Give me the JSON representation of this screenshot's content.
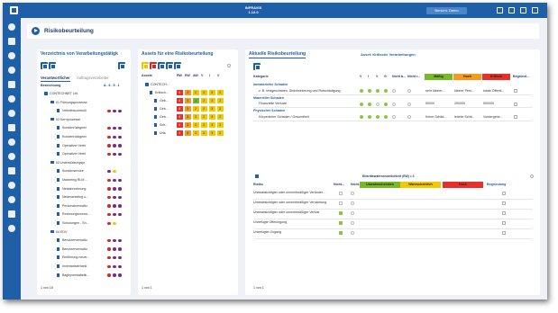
{
  "app": {
    "title_line1": "INFRAVIS",
    "title_line2": "1.12.0",
    "user_button": "Benicht: Demo"
  },
  "page": {
    "title": "Risikobeurteilung"
  },
  "colors": {
    "brand": "#1f5fa8",
    "red": "#e8302a",
    "orange": "#f49a1f",
    "yellow": "#f2c800",
    "green": "#79b829",
    "purple": "#7b2a8a"
  },
  "sidebar_icons": [
    "home-icon",
    "layers-icon",
    "dashboard-icon",
    "gear-icon",
    "clock-icon",
    "calendar-icon",
    "list-icon",
    "document-icon",
    "chart-icon",
    "shield-icon",
    "location-icon",
    "user-icon",
    "report-icon",
    "grid-icon",
    "globe-icon"
  ],
  "left_panel": {
    "title": "Verzeichnis von Verarbeitungstätigk",
    "tabs": [
      "Verantwortlicher",
      "Auftragsverarbeiter"
    ],
    "col_label": "Bezeichnung",
    "col_marks": "A . 6 . 5 . 1",
    "tree": [
      {
        "label": "CONTECHNET Ltd.",
        "level": 0,
        "kind": "folder",
        "dots": []
      },
      {
        "label": "01 Führungsprozesse",
        "level": 1,
        "kind": "folder",
        "dots": []
      },
      {
        "label": "Vertriebscontrolli",
        "level": 2,
        "kind": "doc",
        "dots": [
          "#d62828",
          "#7b2a8a",
          "#7b2a8a"
        ]
      },
      {
        "label": "02 Kernprozesse",
        "level": 1,
        "kind": "folder",
        "dots": []
      },
      {
        "label": "Kundenrückgewi",
        "level": 2,
        "kind": "doc",
        "dots": [
          "#d62828",
          "#7b2a8a",
          "#7b2a8a"
        ]
      },
      {
        "label": "Kundenrückgewi",
        "level": 2,
        "kind": "doc",
        "dots": [
          "#d62828",
          "#7b2a8a",
          "#7b2a8a"
        ]
      },
      {
        "label": "Operativer Vertri",
        "level": 2,
        "kind": "doc",
        "dots": [
          "#d62828",
          "#7b2a8a",
          "#7b2a8a"
        ]
      },
      {
        "label": "Operativer Vertri",
        "level": 2,
        "kind": "doc",
        "dots": [
          "#d62828",
          "#7b2a8a",
          "#7b2a8a"
        ]
      },
      {
        "label": "03 Unterstützungspr",
        "level": 1,
        "kind": "folder",
        "dots": []
      },
      {
        "label": "Kundenservice",
        "level": 2,
        "kind": "doc",
        "dots": [
          "#7b2a8a",
          "#f2c800"
        ]
      },
      {
        "label": "Marketing RLM ...",
        "level": 2,
        "kind": "doc",
        "dots": [
          "#d62828",
          "#7b2a8a",
          "#7b2a8a"
        ]
      },
      {
        "label": "Netzabrechnung",
        "level": 2,
        "kind": "doc",
        "dots": [
          "#d62828",
          "#7b2a8a",
          "#7b2a8a"
        ]
      },
      {
        "label": "Netzmarketing u...",
        "level": 2,
        "kind": "doc",
        "dots": [
          "#d62828",
          "#7b2a8a",
          "#7b2a8a"
        ]
      },
      {
        "label": "Personalverwaltu",
        "level": 2,
        "kind": "doc",
        "dots": [
          "#d62828",
          "#7b2a8a",
          "#7b2a8a"
        ]
      },
      {
        "label": "Rechnungsverwa...",
        "level": 2,
        "kind": "doc",
        "dots": [
          "#d62828",
          "#7b2a8a",
          "#7b2a8a"
        ]
      },
      {
        "label": "Schulungen - Sh...",
        "level": 2,
        "kind": "doc",
        "dots": [
          "#d62828",
          "#f2c800"
        ]
      },
      {
        "label": "04 EDV",
        "level": 1,
        "kind": "folder",
        "dots": []
      },
      {
        "label": "Benutzerverwaltu",
        "level": 2,
        "kind": "doc",
        "dots": [
          "#d62828",
          "#7b2a8a",
          "#7b2a8a"
        ]
      },
      {
        "label": "Benutzerverwaltu",
        "level": 2,
        "kind": "doc",
        "dots": [
          "#d62828",
          "#7b2a8a",
          "#7b2a8a"
        ]
      },
      {
        "label": "Einführung neuer...",
        "level": 2,
        "kind": "doc",
        "dots": [
          "#d62828",
          "#7b2a8a",
          "#7b2a8a"
        ]
      },
      {
        "label": "Inventarisierbank",
        "level": 2,
        "kind": "doc",
        "dots": [
          "#d62828",
          "#7b2a8a",
          "#7b2a8a"
        ]
      },
      {
        "label": "Bagbyverstatistik...",
        "level": 2,
        "kind": "doc",
        "dots": [
          "#d62828",
          "#7b2a8a",
          "#7b2a8a"
        ]
      }
    ],
    "footer": "1 von 18"
  },
  "mid_panel": {
    "title": "Assets für eine Risikobeurteilung",
    "col_label": "Assets",
    "headers": [
      "RW",
      "EW",
      "AW",
      "V",
      "I",
      "V"
    ],
    "rows": [
      {
        "label": "CONTECH...",
        "level": 0,
        "vals": []
      },
      {
        "label": "Kritisch...",
        "level": 1,
        "vals": [
          [
            "4",
            "c-r"
          ],
          [
            "3",
            "c-o"
          ],
          [
            "2",
            "c-y"
          ],
          [
            "2",
            "c-y"
          ],
          [
            "3",
            "c-y"
          ],
          [
            "2",
            "c-y"
          ]
        ]
      },
      {
        "label": "Geb...",
        "level": 2,
        "vals": [
          [
            "4",
            "c-r"
          ],
          [
            "3",
            "c-o"
          ],
          [
            "1",
            "c-g"
          ],
          [
            "2",
            "c-y"
          ],
          [
            "3",
            "c-y"
          ],
          [
            "2",
            "c-y"
          ]
        ]
      },
      {
        "label": "Geb...",
        "level": 2,
        "vals": [
          [
            "4",
            "c-r"
          ],
          [
            "3",
            "c-o"
          ],
          [
            "2",
            "c-y"
          ],
          [
            "2",
            "c-y"
          ],
          [
            "3",
            "c-y"
          ],
          [
            "2",
            "c-y"
          ]
        ]
      },
      {
        "label": "Geb...",
        "level": 2,
        "vals": [
          [
            "4",
            "c-r"
          ],
          [
            "3",
            "c-o"
          ],
          [
            "2",
            "c-y"
          ],
          [
            "2",
            "c-y"
          ],
          [
            "3",
            "c-y"
          ],
          [
            "2",
            "c-y"
          ]
        ]
      },
      {
        "label": "Sch...",
        "level": 2,
        "vals": [
          [
            "4",
            "c-r"
          ],
          [
            "3",
            "c-o"
          ],
          [
            "2",
            "c-y"
          ],
          [
            "2",
            "c-y"
          ],
          [
            "3",
            "c-y"
          ],
          [
            "2",
            "c-y"
          ]
        ]
      },
      {
        "label": "Urla",
        "level": 2,
        "vals": [
          [
            "4",
            "c-r"
          ],
          [
            "3",
            "c-o"
          ],
          [
            "2",
            "c-y"
          ],
          [
            "2",
            "c-y"
          ],
          [
            "3",
            "c-y"
          ],
          [
            "2",
            "c-y"
          ]
        ]
      }
    ],
    "footer": "1 von 1"
  },
  "right_panel": {
    "title": "Aktuelle Risikobeurteilung",
    "tab2": "Asset: Kritische Verarbeitungen",
    "top_headers": {
      "kategorie": "Kategorie",
      "v": "V",
      "i": "I",
      "v2": "V",
      "g": "G",
      "nicht_b": "Nicht b...",
      "nicht_r": "Nicht r...",
      "low": "Mäßig",
      "med": "Hoch",
      "high": "Kritisch",
      "begr": "Begründ..."
    },
    "top_rows": [
      {
        "type": "cat",
        "label": "Immaterieller Schaden"
      },
      {
        "type": "data",
        "label": "z. B. Imageschaden, Diskriminierung und Rufschädigung",
        "checks": [
          "on",
          "on",
          "on",
          "on",
          "off",
          "off"
        ],
        "cells": [
          "sehr kleiner...",
          "kleiner Pers...",
          "totale Öffentl..."
        ]
      },
      {
        "type": "cat",
        "label": "Materieller Schaden"
      },
      {
        "type": "data",
        "label": "Finanzielle Verluste",
        "checks": [
          "on",
          "on",
          "off",
          "on",
          "off",
          "off"
        ],
        "cells": [
          "50000",
          "200000",
          "500000"
        ]
      },
      {
        "type": "cat",
        "label": "Physischer Schaden"
      },
      {
        "type": "data",
        "label": "Körperlicher Schaden / Gesundheit",
        "checks": [
          "on",
          "on",
          "on",
          "on",
          "off",
          "off"
        ],
        "cells": [
          "Keine Schäd...",
          "leichte Schä...",
          "Vordergehe..."
        ]
      }
    ],
    "bottom_top_label": "Eintrittswahrscheinlichkeit (EW) = 3",
    "bottom_headers": {
      "risiko": "Risiko",
      "nicht": "Nicht...",
      "nicht2": "Nicht...",
      "low": "Unwahrscheinlich",
      "mid": "Wahrscheinlich",
      "high": "Hoch",
      "begr": "Begründung"
    },
    "bottom_rows": [
      {
        "label": "Unbeabsichtigter oder unrechtmäßiger Veränder...",
        "c1": "box-off",
        "c2": "off"
      },
      {
        "label": "Unbeabsichtigter oder unrechtmäßiger Vernichtung",
        "c1": "box-off",
        "c2": "off"
      },
      {
        "label": "Unbeabsichtigter oder unrechtmäßiger Verlust",
        "c1": "box-on",
        "c2": "off"
      },
      {
        "label": "Unbefugte Offenlegung",
        "c1": "box-on",
        "c2": "off"
      },
      {
        "label": "Unbefugter Zugang",
        "c1": "box-on",
        "c2": "off"
      }
    ],
    "footer": "1 von 1"
  }
}
